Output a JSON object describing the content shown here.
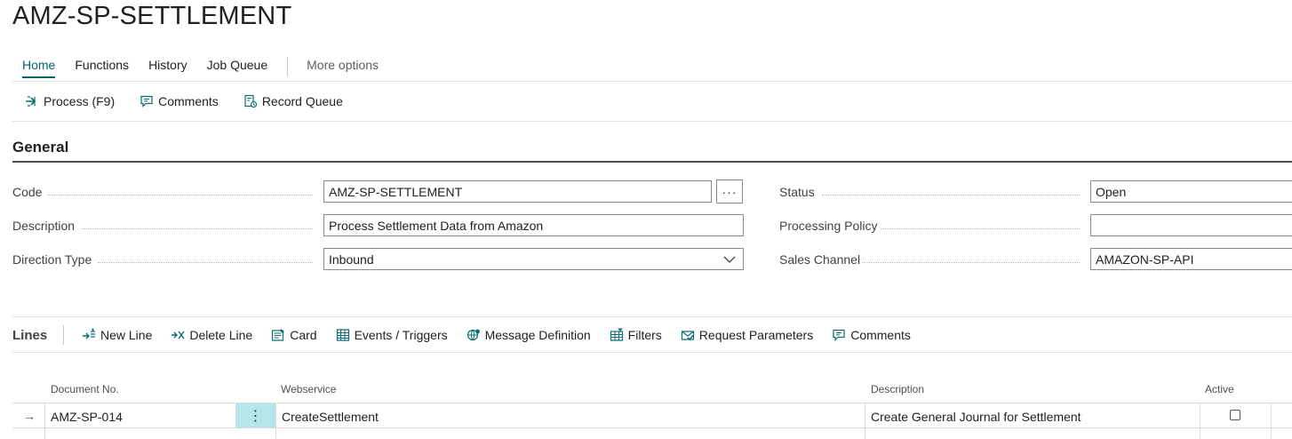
{
  "page": {
    "title": "AMZ-SP-SETTLEMENT"
  },
  "tabs": [
    {
      "label": "Home",
      "active": true
    },
    {
      "label": "Functions"
    },
    {
      "label": "History"
    },
    {
      "label": "Job Queue"
    }
  ],
  "more_options": "More options",
  "actions": {
    "process": "Process (F9)",
    "comments": "Comments",
    "record_queue": "Record Queue"
  },
  "general": {
    "title": "General",
    "code_label": "Code",
    "code_value": "AMZ-SP-SETTLEMENT",
    "description_label": "Description",
    "description_value": "Process Settlement Data from Amazon",
    "direction_label": "Direction Type",
    "direction_value": "Inbound",
    "status_label": "Status",
    "status_value": "Open",
    "policy_label": "Processing Policy",
    "policy_value": "",
    "channel_label": "Sales Channel",
    "channel_value": "AMAZON-SP-API",
    "lookup_glyph": "···"
  },
  "lines": {
    "title": "Lines",
    "actions": {
      "new_line": "New Line",
      "delete_line": "Delete Line",
      "card": "Card",
      "events": "Events / Triggers",
      "message_def": "Message Definition",
      "filters": "Filters",
      "request_params": "Request Parameters",
      "comments": "Comments"
    },
    "columns": {
      "doc_no": "Document No.",
      "webservice": "Webservice",
      "description": "Description",
      "active": "Active"
    },
    "rows": [
      {
        "arrow": "→",
        "doc_no": "AMZ-SP-014",
        "menu": "⋮",
        "webservice": "CreateSettlement",
        "description": "Create General Journal for Settlement",
        "active": false
      }
    ]
  },
  "colors": {
    "accent": "#00656b",
    "selected_cell": "#b3e5ea",
    "icon": "#0a6d73"
  }
}
